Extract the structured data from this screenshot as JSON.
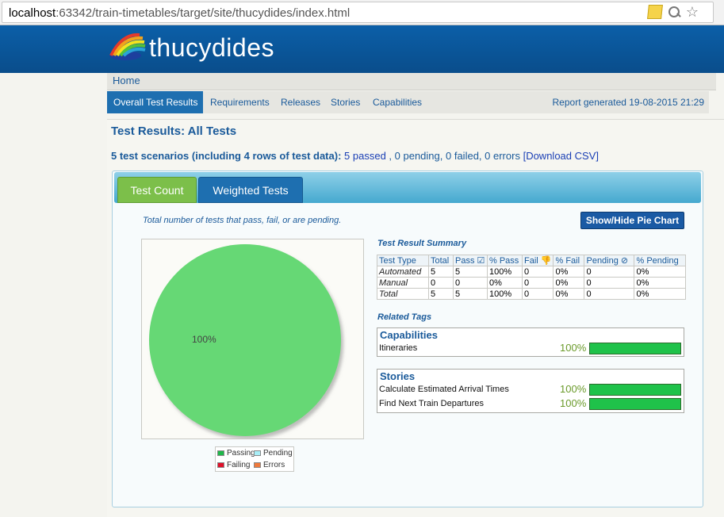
{
  "browser": {
    "url_host": "localhost",
    "url_path": ":63342/train-timetables/target/site/thucydides/index.html"
  },
  "header": {
    "logo_text": "thucydides"
  },
  "breadcrumb": {
    "home": "Home"
  },
  "nav": {
    "items": [
      {
        "label": "Overall Test Results",
        "active": true
      },
      {
        "label": "Requirements"
      },
      {
        "label": "Releases"
      },
      {
        "label": "Stories"
      },
      {
        "label": "Capabilities"
      }
    ],
    "report_generated": "Report generated 19-08-2015 21:29"
  },
  "page": {
    "title": "Test Results: All Tests",
    "summary_bold": "5 test scenarios (including 4 rows of test data):",
    "passed": "5 passed",
    "sep1": " , ",
    "pending": "0 pending",
    "sep2": ", ",
    "failed": "0 failed",
    "sep3": ", ",
    "errors": "0 errors",
    "download": "[Download CSV]"
  },
  "tabs": {
    "test_count": "Test Count",
    "weighted_tests": "Weighted Tests"
  },
  "chart_caption": "Total number of tests that pass, fail, or are pending.",
  "toggle_button": "Show/Hide Pie Chart",
  "chart_data": {
    "type": "pie",
    "slices": [
      {
        "label": "Passing",
        "value": 100,
        "color": "#66d874"
      },
      {
        "label": "Pending",
        "value": 0,
        "color": "#a8eef7"
      },
      {
        "label": "Failing",
        "value": 0,
        "color": "#e0102a"
      },
      {
        "label": "Errors",
        "value": 0,
        "color": "#f07a3c"
      }
    ],
    "slice_label": "100%"
  },
  "legend": {
    "passing": "Passing",
    "pending": "Pending",
    "failing": "Failing",
    "errors": "Errors",
    "colors": {
      "passing": "#1fb84a",
      "pending": "#a8eef7",
      "failing": "#e0102a",
      "errors": "#f07a3c"
    }
  },
  "summary_table": {
    "title": "Test Result Summary",
    "headers": [
      "Test Type",
      "Total",
      "Pass ☑",
      "% Pass",
      "Fail 👎",
      "% Fail",
      "Pending ⊘",
      "% Pending"
    ],
    "rows": [
      [
        "Automated",
        "5",
        "5",
        "100%",
        "0",
        "0%",
        "0",
        "0%"
      ],
      [
        "Manual",
        "0",
        "0",
        "0%",
        "0",
        "0%",
        "0",
        "0%"
      ],
      [
        "Total",
        "5",
        "5",
        "100%",
        "0",
        "0%",
        "0",
        "0%"
      ]
    ]
  },
  "related_tags": {
    "title": "Related Tags",
    "capabilities": {
      "title": "Capabilities",
      "items": [
        {
          "name": "Itineraries",
          "pct": "100%",
          "fill": 1.0
        }
      ]
    },
    "stories": {
      "title": "Stories",
      "items": [
        {
          "name": "Calculate Estimated Arrival Times",
          "pct": "100%",
          "fill": 1.0
        },
        {
          "name": "Find Next Train Departures",
          "pct": "100%",
          "fill": 1.0
        }
      ]
    }
  }
}
